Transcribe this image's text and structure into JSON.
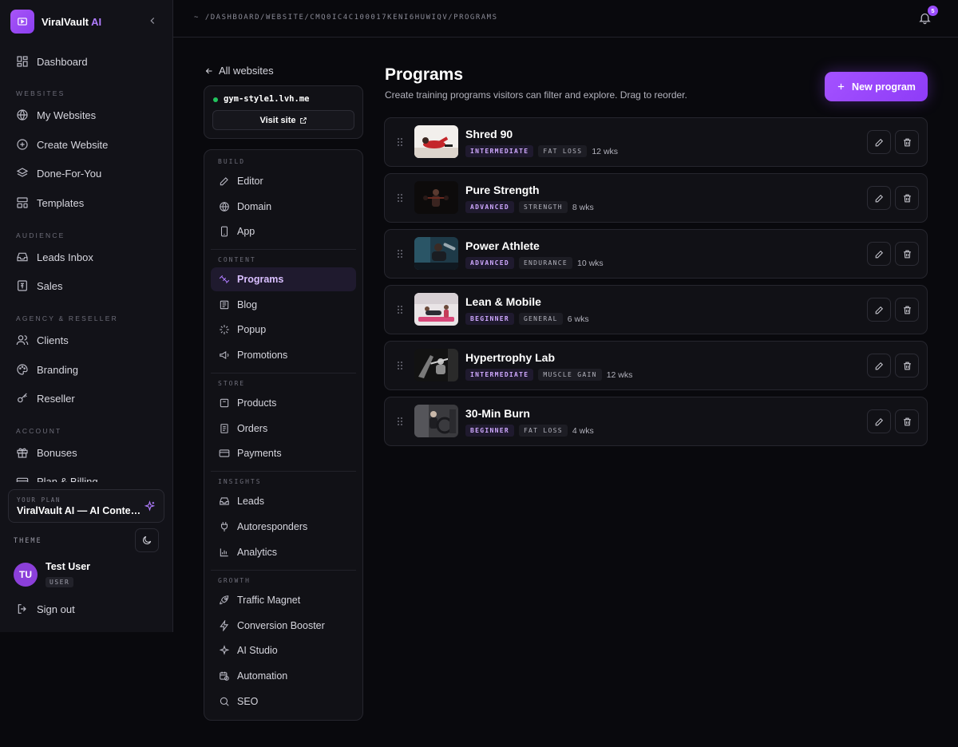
{
  "brand": {
    "name": "ViralVault",
    "suffix": "AI"
  },
  "sidebar": {
    "dashboard": "Dashboard",
    "sections": {
      "websites": "WEBSITES",
      "audience": "AUDIENCE",
      "agency": "AGENCY & RESELLER",
      "account": "ACCOUNT"
    },
    "items": {
      "my_websites": "My Websites",
      "create_website": "Create Website",
      "done_for_you": "Done-For-You",
      "templates": "Templates",
      "leads_inbox": "Leads Inbox",
      "sales": "Sales",
      "clients": "Clients",
      "branding": "Branding",
      "reseller": "Reseller",
      "bonuses": "Bonuses",
      "plan_billing": "Plan & Billing"
    },
    "plan": {
      "label": "YOUR PLAN",
      "name": "ViralVault AI — AI Content Suite"
    },
    "theme_label": "THEME",
    "user": {
      "initials": "TU",
      "name": "Test User",
      "role": "USER"
    },
    "sign_out": "Sign out"
  },
  "topbar": {
    "breadcrumb": "~ /DASHBOARD/WEBSITE/CMQ0IC4C100017KENI6HUWIQV/PROGRAMS",
    "notification_count": "5"
  },
  "subnav": {
    "back_label": "All websites",
    "site_domain": "gym-style1.lvh.me",
    "visit_label": "Visit site",
    "sections": {
      "build": "BUILD",
      "content": "CONTENT",
      "store": "STORE",
      "insights": "INSIGHTS",
      "growth": "GROWTH"
    },
    "items": {
      "editor": "Editor",
      "domain": "Domain",
      "app": "App",
      "programs": "Programs",
      "blog": "Blog",
      "popup": "Popup",
      "promotions": "Promotions",
      "products": "Products",
      "orders": "Orders",
      "payments": "Payments",
      "leads": "Leads",
      "autoresponders": "Autoresponders",
      "analytics": "Analytics",
      "traffic_magnet": "Traffic Magnet",
      "conversion_booster": "Conversion Booster",
      "ai_studio": "AI Studio",
      "automation": "Automation",
      "seo": "SEO"
    }
  },
  "main": {
    "title": "Programs",
    "subtitle": "Create training programs visitors can filter and explore. Drag to reorder.",
    "new_button": "New program",
    "programs": [
      {
        "name": "Shred 90",
        "level": "INTERMEDIATE",
        "category": "FAT LOSS",
        "weeks": "12 wks"
      },
      {
        "name": "Pure Strength",
        "level": "ADVANCED",
        "category": "STRENGTH",
        "weeks": "8 wks"
      },
      {
        "name": "Power Athlete",
        "level": "ADVANCED",
        "category": "ENDURANCE",
        "weeks": "10 wks"
      },
      {
        "name": "Lean & Mobile",
        "level": "BEGINNER",
        "category": "GENERAL",
        "weeks": "6 wks"
      },
      {
        "name": "Hypertrophy Lab",
        "level": "INTERMEDIATE",
        "category": "MUSCLE GAIN",
        "weeks": "12 wks"
      },
      {
        "name": "30-Min Burn",
        "level": "BEGINNER",
        "category": "FAT LOSS",
        "weeks": "4 wks"
      }
    ]
  },
  "colors": {
    "accent": "#a855f7",
    "background": "#09090d",
    "online": "#22c55e"
  }
}
